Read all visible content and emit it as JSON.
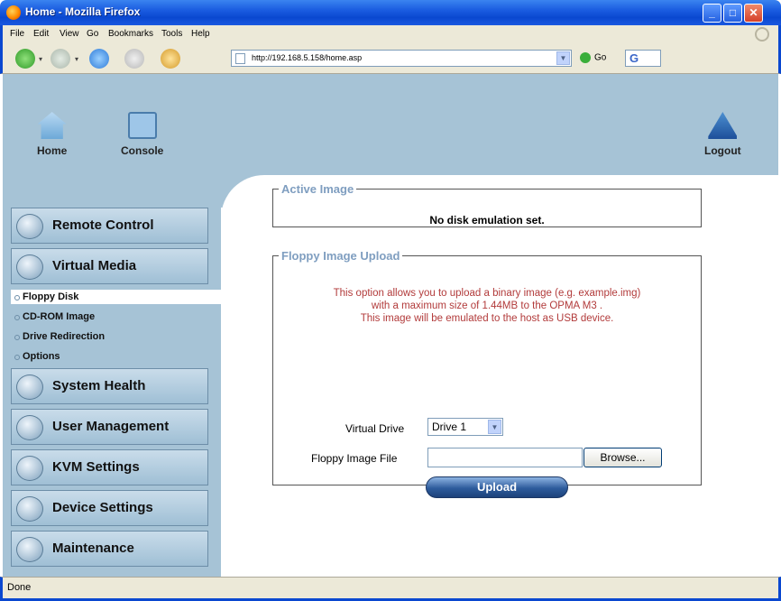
{
  "window": {
    "title": "Home - Mozilla Firefox"
  },
  "menu": [
    "File",
    "Edit",
    "View",
    "Go",
    "Bookmarks",
    "Tools",
    "Help"
  ],
  "toolbar": {
    "url": "http://192.168.5.158/home.asp",
    "go_label": "Go",
    "search_logo": "G"
  },
  "topnav": {
    "home": "Home",
    "console": "Console",
    "logout": "Logout"
  },
  "sidebar": {
    "sections": [
      "Remote Control",
      "Virtual Media",
      "System Health",
      "User Management",
      "KVM Settings",
      "Device Settings",
      "Maintenance"
    ],
    "virtual_media_items": [
      "Floppy Disk",
      "CD-ROM Image",
      "Drive Redirection",
      "Options"
    ]
  },
  "active_image": {
    "legend": "Active Image",
    "message": "No disk emulation set."
  },
  "upload": {
    "legend": "Floppy Image Upload",
    "desc1": "This option allows you to upload a binary image (e.g. example.img)",
    "desc2": "with a maximum size of 1.44MB to the OPMA M3 .",
    "desc3": "This image will be emulated to the host as USB device.",
    "drive_label": "Virtual Drive",
    "drive_value": "Drive 1",
    "file_label": "Floppy Image File",
    "browse_label": "Browse...",
    "upload_label": "Upload"
  },
  "status": "Done",
  "colors": {
    "banner": "#a6c3d6",
    "legend": "#7f9ec0",
    "desc": "#b23b3b"
  }
}
